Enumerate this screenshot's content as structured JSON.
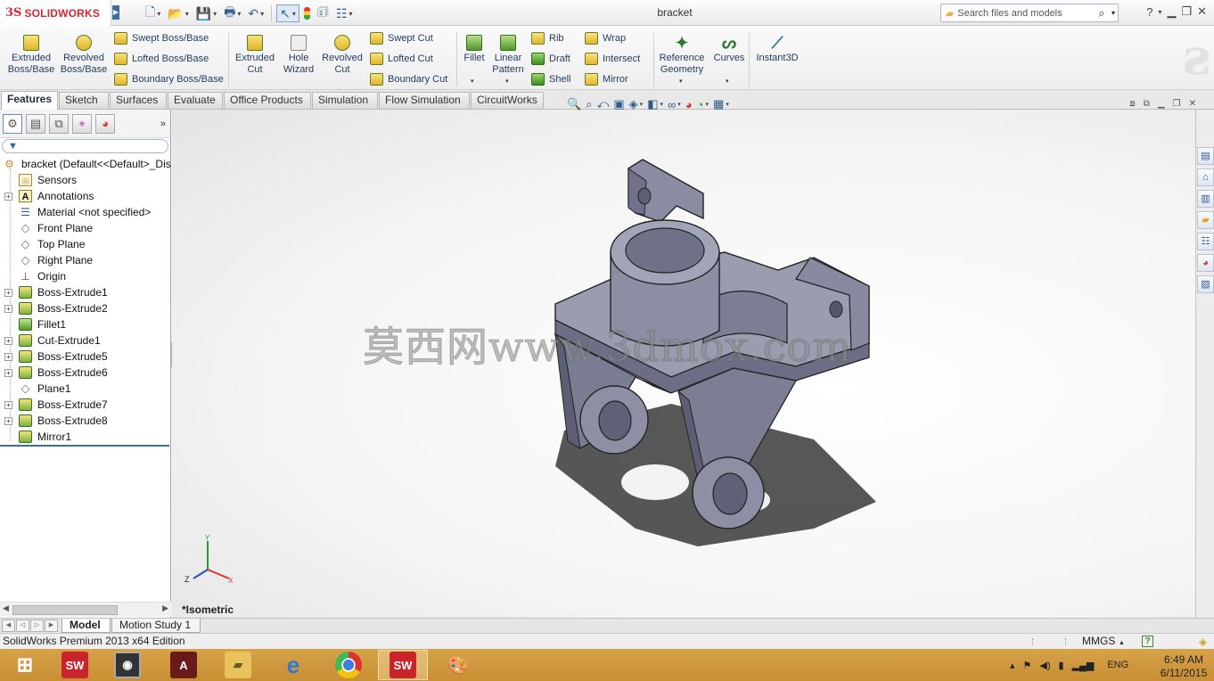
{
  "app": {
    "logo_ds": "3S",
    "logo_text": "SOLIDWORKS",
    "document_title": "bracket"
  },
  "search": {
    "placeholder": "Search files and models",
    "icon": "magnifier-icon"
  },
  "help_label": "?",
  "ribbon": {
    "extruded_boss": "Extruded\nBoss/Base",
    "revolved_boss": "Revolved\nBoss/Base",
    "swept_boss": "Swept Boss/Base",
    "lofted_boss": "Lofted Boss/Base",
    "boundary_boss": "Boundary Boss/Base",
    "extruded_cut": "Extruded\nCut",
    "hole_wizard": "Hole\nWizard",
    "revolved_cut": "Revolved\nCut",
    "swept_cut": "Swept Cut",
    "lofted_cut": "Lofted Cut",
    "boundary_cut": "Boundary Cut",
    "fillet": "Fillet",
    "linear_pattern": "Linear\nPattern",
    "rib": "Rib",
    "draft": "Draft",
    "shell": "Shell",
    "wrap": "Wrap",
    "intersect": "Intersect",
    "mirror": "Mirror",
    "reference_geometry": "Reference\nGeometry",
    "curves": "Curves",
    "instant3d": "Instant3D"
  },
  "tabs": [
    "Features",
    "Sketch",
    "Surfaces",
    "Evaluate",
    "Office Products",
    "Simulation",
    "Flow Simulation",
    "CircuitWorks"
  ],
  "feature_tree": {
    "root": "bracket  (Default<<Default>_Dis",
    "items": [
      {
        "label": "Sensors",
        "icon": "sensor-icon",
        "expandable": false
      },
      {
        "label": "Annotations",
        "icon": "annotation-icon",
        "expandable": true
      },
      {
        "label": "Material <not specified>",
        "icon": "material-icon",
        "expandable": false
      },
      {
        "label": "Front Plane",
        "icon": "plane-icon",
        "expandable": false
      },
      {
        "label": "Top Plane",
        "icon": "plane-icon",
        "expandable": false
      },
      {
        "label": "Right Plane",
        "icon": "plane-icon",
        "expandable": false
      },
      {
        "label": "Origin",
        "icon": "origin-icon",
        "expandable": false
      },
      {
        "label": "Boss-Extrude1",
        "icon": "extrude-icon",
        "expandable": true
      },
      {
        "label": "Boss-Extrude2",
        "icon": "extrude-icon",
        "expandable": true
      },
      {
        "label": "Fillet1",
        "icon": "fillet-icon",
        "expandable": false
      },
      {
        "label": "Cut-Extrude1",
        "icon": "cut-icon",
        "expandable": true
      },
      {
        "label": "Boss-Extrude5",
        "icon": "extrude-icon",
        "expandable": true
      },
      {
        "label": "Boss-Extrude6",
        "icon": "extrude-icon",
        "expandable": true
      },
      {
        "label": "Plane1",
        "icon": "plane-icon",
        "expandable": false
      },
      {
        "label": "Boss-Extrude7",
        "icon": "extrude-icon",
        "expandable": true
      },
      {
        "label": "Boss-Extrude8",
        "icon": "extrude-icon",
        "expandable": true
      },
      {
        "label": "Mirror1",
        "icon": "mirror-icon",
        "expandable": false
      }
    ]
  },
  "viewport": {
    "view_name": "*Isometric",
    "watermark": "莫西网www.3dmox.com",
    "triad": {
      "y": "Y",
      "z": "Z",
      "x": "X"
    }
  },
  "bottom_tabs": [
    "Model",
    "Motion Study 1"
  ],
  "status": {
    "edition": "SolidWorks Premium 2013 x64 Edition",
    "units": "MMGS"
  },
  "taskbar": {
    "lang": "ENG",
    "time": "6:49 AM",
    "date": "6/11/2015",
    "apps": [
      "start-icon",
      "solidworks-icon",
      "app-icon",
      "autocad-icon",
      "file-explorer-icon",
      "ie-icon",
      "chrome-icon",
      "solidworks-active-icon",
      "paint-icon"
    ]
  },
  "colors": {
    "part_body": "#8c8fa3",
    "solidworks_red": "#d7262e",
    "taskbar": "#d19b42",
    "selection_blue": "#3b6ea8"
  }
}
